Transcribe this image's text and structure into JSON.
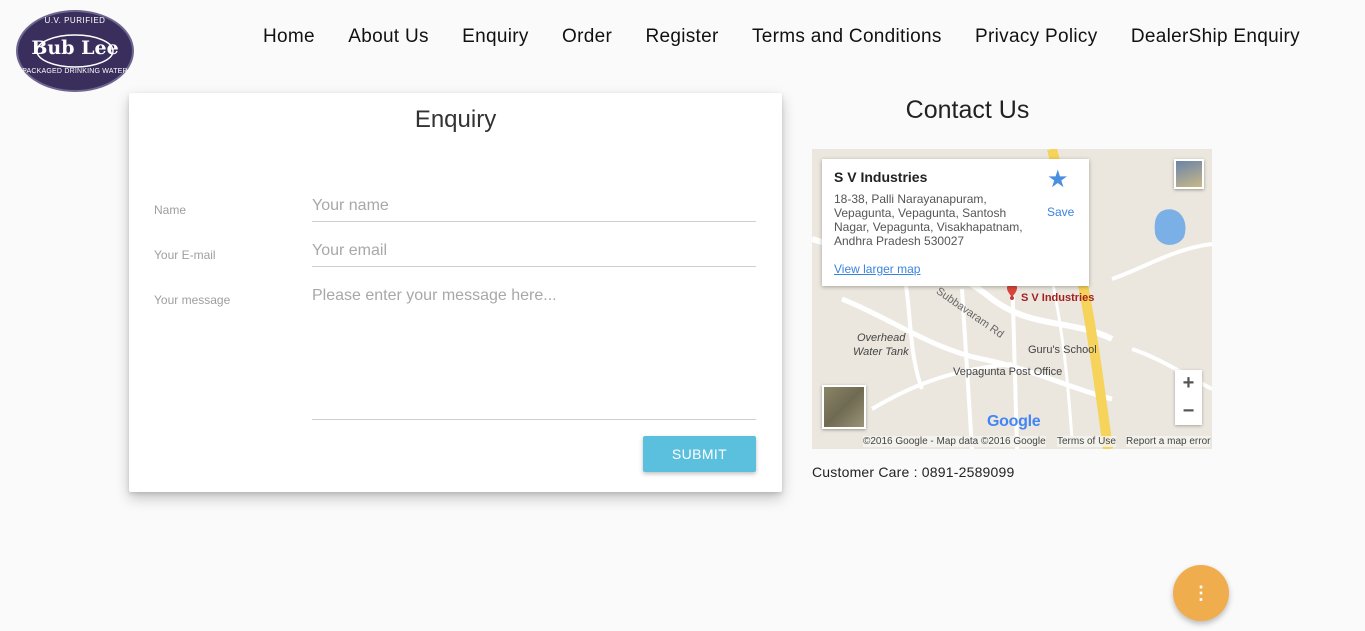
{
  "logo": {
    "top_text": "U.V. PURIFIED",
    "main_text": "Bub Lee",
    "bottom_text": "PACKAGED DRINKING WATER"
  },
  "nav": {
    "items": [
      {
        "label": "Home"
      },
      {
        "label": "About Us"
      },
      {
        "label": "Enquiry"
      },
      {
        "label": "Order"
      },
      {
        "label": "Register"
      },
      {
        "label": "Terms and Conditions"
      },
      {
        "label": "Privacy Policy"
      },
      {
        "label": "DealerShip Enquiry"
      }
    ]
  },
  "enquiry": {
    "title": "Enquiry",
    "name_label": "Name",
    "name_placeholder": "Your name",
    "email_label": "Your E-mail",
    "email_placeholder": "Your email",
    "message_label": "Your message",
    "message_placeholder": "Please enter your message here...",
    "submit_label": "SUBMIT"
  },
  "contact": {
    "title": "Contact Us",
    "customer_care": "Customer Care : 0891-2589099"
  },
  "map": {
    "place_name": "S V Industries",
    "address": "18-38, Palli Narayanapuram, Vepagunta, Vepagunta, Santosh Nagar, Vepagunta, Visakhapatnam, Andhra Pradesh 530027",
    "save_label": "Save",
    "view_larger": "View larger map",
    "pin_label": "S V Industries",
    "labels": {
      "overhead": "Overhead",
      "water_tank": "Water Tank",
      "road": "Subbavaram Rd",
      "school": "Guru's School",
      "post_office": "Vepagunta Post Office"
    },
    "zoom_in": "+",
    "zoom_out": "−",
    "google": "Google",
    "copyright": "©2016 Google - Map data ©2016 Google",
    "terms": "Terms of Use",
    "report": "Report a map error"
  },
  "fab": {
    "icon": "more-vertical-icon",
    "glyph": "⋮"
  },
  "colors": {
    "submit": "#5bc0de",
    "fab": "#f0ad4e",
    "link": "#3a84df",
    "background": "#fafafa"
  }
}
